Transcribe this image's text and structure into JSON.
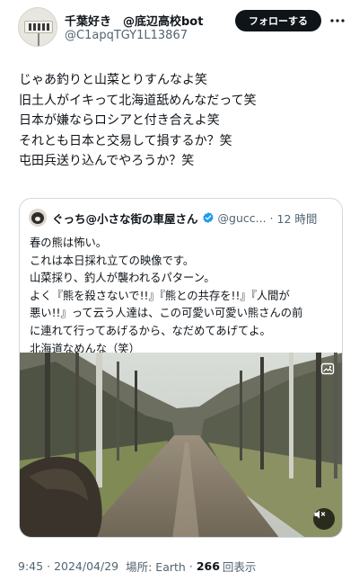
{
  "author": {
    "display_name": "千葉好き　@底辺高校bot",
    "handle": "@C1apqTGY1L13867",
    "follow_label": "フォローする",
    "more_icon": "more-dots-icon"
  },
  "tweet": {
    "lines": [
      "じゃあ釣りと山菜とりすんなよ笑",
      "旧土人がイキって北海道舐めんなだって笑",
      "日本が嫌ならロシアと付き合えよ笑",
      "それとも日本と交易して損するか？笑",
      "屯田兵送り込んでやろうか？笑"
    ]
  },
  "quote": {
    "name": "ぐっち@小さな街の車屋さん",
    "verified_color": "#1d9bf0",
    "handle": "@gucc...",
    "separator": "·",
    "time": "12 時間",
    "lines": [
      "春の熊は怖い。",
      "これは本日採れ立ての映像です。",
      "山菜採り、釣人が襲われるパターン。",
      "よく『熊を殺さないで!!』『熊との共存を!!』『人間が",
      "悪い!!』って云う人達は、この可愛い可愛い熊さんの前",
      "に連れて行ってあげるから、なだめてあげてよ。",
      "北海道なめんな（笑）"
    ],
    "media": {
      "type": "video",
      "alt_icon": "alt-badge-icon",
      "mute_icon": "mute-icon"
    }
  },
  "meta": {
    "time": "9:45",
    "dot1": "·",
    "date": "2024/04/29",
    "location_label": "場所: Earth",
    "dot2": "·",
    "views_count": "266",
    "views_label": "回表示"
  }
}
